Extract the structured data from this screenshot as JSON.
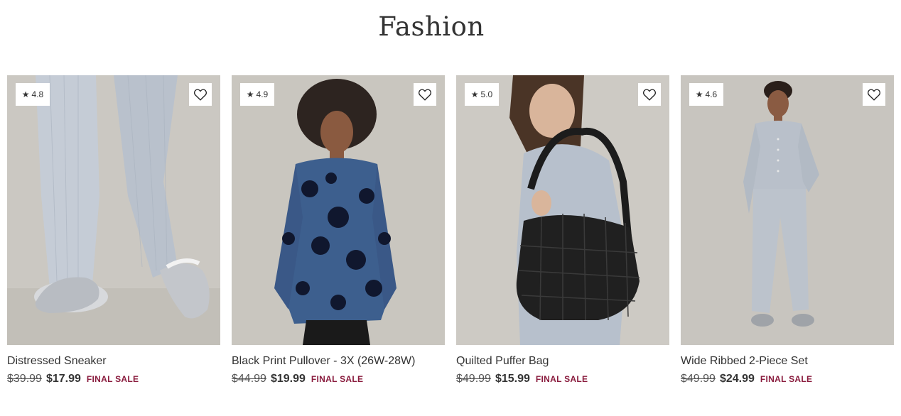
{
  "page": {
    "title": "Fashion"
  },
  "icons": {
    "rating": "star-icon",
    "favorite": "heart-outline-icon"
  },
  "colors": {
    "final_sale": "#8a1c3e",
    "text": "#333333",
    "photo_bg": "#c9c6c0"
  },
  "products": [
    {
      "rating": "4.8",
      "name": "Distressed Sneaker",
      "old_price": "$39.99",
      "price": "$17.99",
      "tag": "FINAL SALE"
    },
    {
      "rating": "4.9",
      "name": "Black Print Pullover - 3X (26W-28W)",
      "old_price": "$44.99",
      "price": "$19.99",
      "tag": "FINAL SALE"
    },
    {
      "rating": "5.0",
      "name": "Quilted Puffer Bag",
      "old_price": "$49.99",
      "price": "$15.99",
      "tag": "FINAL SALE"
    },
    {
      "rating": "4.6",
      "name": "Wide Ribbed 2-Piece Set",
      "old_price": "$49.99",
      "price": "$24.99",
      "tag": "FINAL SALE"
    }
  ]
}
